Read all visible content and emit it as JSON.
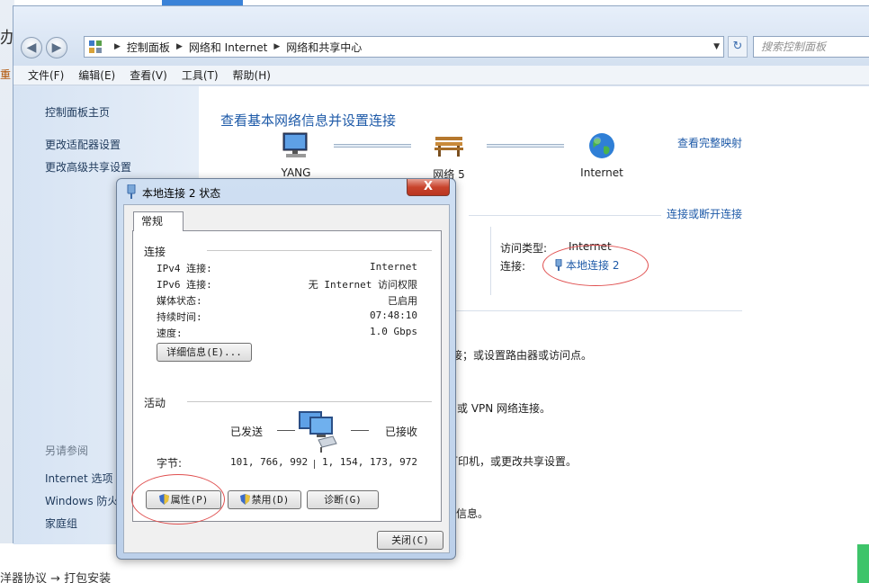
{
  "background": {
    "left_char_top": "办",
    "left_char_mid": "重",
    "bottom_text": "洋器协议 → 打包安装"
  },
  "window": {
    "breadcrumbs": [
      "控制面板",
      "网络和 Internet",
      "网络和共享中心"
    ],
    "search_placeholder": "搜索控制面板",
    "menu": [
      "文件(F)",
      "编辑(E)",
      "查看(V)",
      "工具(T)",
      "帮助(H)"
    ]
  },
  "sidebar": {
    "home": "控制面板主页",
    "links": [
      "更改适配器设置",
      "更改高级共享设置"
    ],
    "see_also_heading": "另请参阅",
    "see_also": [
      "Internet 选项",
      "Windows 防火墙",
      "家庭组"
    ]
  },
  "content": {
    "title": "查看基本网络信息并设置连接",
    "view_full_map": "查看完整映射",
    "nodes": {
      "computer": "YANG",
      "network": "网络  5",
      "internet": "Internet"
    },
    "connect_disconnect": "连接或断开连接",
    "access_type_label": "访问类型:",
    "access_type_value": "Internet",
    "connection_label": "连接:",
    "connection_value": "本地连接 2",
    "texts": [
      "接；或设置路由器或访问点。",
      "或 VPN 网络连接。",
      "打印机，或更改共享设置。",
      "信息。"
    ]
  },
  "dialog": {
    "title": "本地连接 2 状态",
    "close_glyph": "X",
    "tab": "常规",
    "connection_heading": "连接",
    "rows": [
      {
        "label": "IPv4 连接:",
        "value": "Internet"
      },
      {
        "label": "IPv6 连接:",
        "value": "无 Internet 访问权限"
      },
      {
        "label": "媒体状态:",
        "value": "已启用"
      },
      {
        "label": "持续时间:",
        "value": "07:48:10"
      },
      {
        "label": "速度:",
        "value": "1.0 Gbps"
      }
    ],
    "details_button": "详细信息(E)...",
    "activity_heading": "活动",
    "sent_label": "已发送",
    "received_label": "已接收",
    "bytes_label": "字节:",
    "bytes_sent": "101, 766, 992",
    "bytes_received": "1, 154, 173, 972",
    "properties_button": "属性(P)",
    "disable_button": "禁用(D)",
    "diagnose_button": "诊断(G)",
    "close_button": "关闭(C)"
  },
  "colors": {
    "link": "#1e5aa8",
    "annotation": "#e05050",
    "close_red": "#c8442d"
  }
}
